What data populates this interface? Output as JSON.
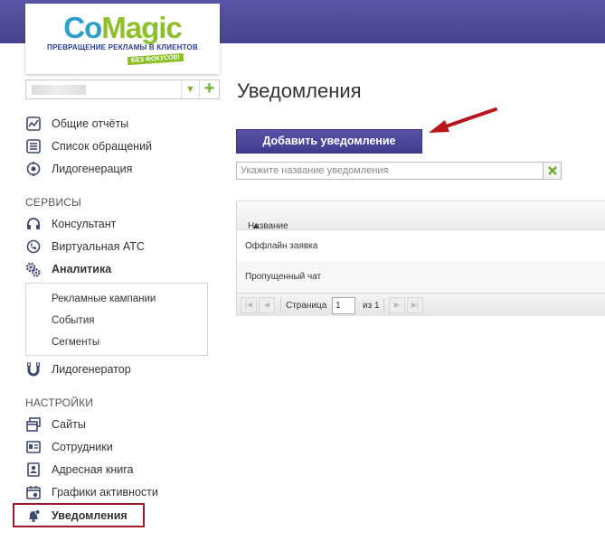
{
  "logo": {
    "part1": "Co",
    "part2": "Magic",
    "tagline": "ПРЕВРАЩЕНИЕ РЕКЛАМЫ В КЛИЕНТОВ",
    "badge": "БЕЗ ФОКУСОВ!"
  },
  "colors": {
    "topbar": "#4e4a9c",
    "accent_green": "#7ab531",
    "button": "#4a469a",
    "highlight": "#a0182a"
  },
  "sidebar": {
    "top_items": [
      {
        "label": "Общие отчёты",
        "icon": "chart-line-icon"
      },
      {
        "label": "Список обращений",
        "icon": "list-icon"
      },
      {
        "label": "Лидогенерация",
        "icon": "target-icon"
      }
    ],
    "services_heading": "СЕРВИСЫ",
    "services": [
      {
        "label": "Консультант",
        "icon": "headset-icon"
      },
      {
        "label": "Виртуальная АТС",
        "icon": "phone-icon"
      },
      {
        "label": "Аналитика",
        "icon": "gears-icon"
      }
    ],
    "analytics_sub": [
      "Рекламные кампании",
      "События",
      "Сегменты"
    ],
    "leadgen": {
      "label": "Лидогенератор",
      "icon": "magnet-icon"
    },
    "settings_heading": "НАСТРОЙКИ",
    "settings": [
      {
        "label": "Сайты",
        "icon": "windows-icon"
      },
      {
        "label": "Сотрудники",
        "icon": "id-card-icon"
      },
      {
        "label": "Адресная книга",
        "icon": "address-book-icon"
      },
      {
        "label": "Графики активности",
        "icon": "calendar-icon"
      },
      {
        "label": "Уведомления",
        "icon": "bell-icon"
      }
    ]
  },
  "main": {
    "title": "Уведомления",
    "add_button": "Добавить уведомление",
    "filter_placeholder": "Укажите название уведомления",
    "grid": {
      "column": "Название",
      "rows": [
        "Оффлайн заявка",
        "Пропущенный чат"
      ]
    },
    "pager": {
      "page_label": "Страница",
      "page": "1",
      "of_label": "из 1"
    }
  }
}
